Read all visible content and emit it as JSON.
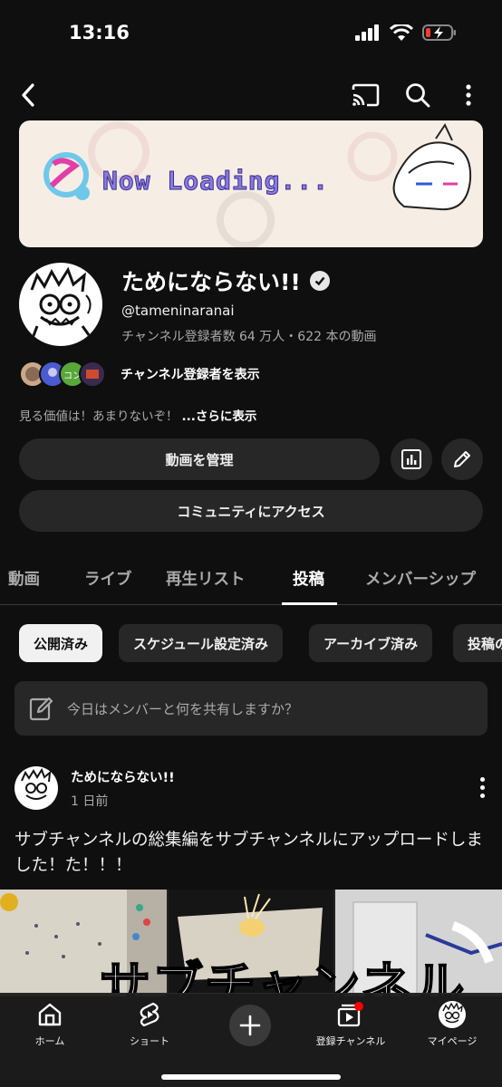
{
  "status_bar": {
    "time": "13:16"
  },
  "banner": {
    "text": "Now Loading..."
  },
  "channel": {
    "name": "ためにならない!!",
    "handle": "@tameninaranai",
    "stats": "チャンネル登録者数 64 万人・622 本の動画",
    "subscribers_link": "チャンネル登録者を表示",
    "subscriber_badge": "コン",
    "description": "見る価値は！あまりないぞ！",
    "more": "...さらに表示",
    "manage_videos": "動画を管理",
    "community": "コミュニティにアクセス"
  },
  "tabs": [
    {
      "label": "動画",
      "active": false
    },
    {
      "label": "ライブ",
      "active": false
    },
    {
      "label": "再生リスト",
      "active": false
    },
    {
      "label": "投稿",
      "active": true
    },
    {
      "label": "メンバーシップ",
      "active": false
    }
  ],
  "chips": [
    {
      "label": "公開済み",
      "active": true
    },
    {
      "label": "スケジュール設定済み",
      "active": false
    },
    {
      "label": "アーカイブ済み",
      "active": false
    },
    {
      "label": "投稿の",
      "active": false
    }
  ],
  "composer": {
    "placeholder": "今日はメンバーと何を共有しますか？"
  },
  "post": {
    "author": "ためにならない!!",
    "time": "1 日前",
    "text": "サブチャンネルの総集編をサブチャンネルにアップロードしました！た！！！",
    "image_caption": "サブチャンネル"
  },
  "bottom_nav": [
    {
      "label": "ホーム",
      "icon": "home-icon"
    },
    {
      "label": "ショート",
      "icon": "shorts-icon"
    },
    {
      "label": "",
      "icon": "create-icon"
    },
    {
      "label": "登録チャンネル",
      "icon": "subscriptions-icon"
    },
    {
      "label": "マイページ",
      "icon": "profile-icon"
    }
  ],
  "colors": {
    "background": "#0f0f0f",
    "surface": "#272727",
    "text": "#f1f1f1",
    "secondary": "#aaaaaa",
    "badge": "#ff0000"
  }
}
